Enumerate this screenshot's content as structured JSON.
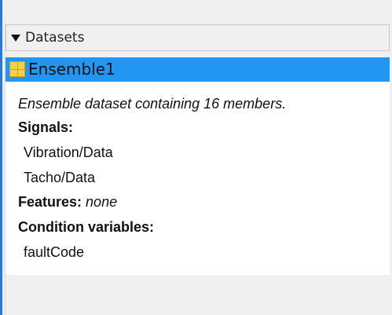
{
  "panel": {
    "section_title": "Datasets",
    "selected_item": "Ensemble1",
    "description": "Ensemble dataset containing 16 members.",
    "signals_label": "Signals:",
    "signals": [
      "Vibration/Data",
      "Tacho/Data"
    ],
    "features_label": "Features:",
    "features_value": "none",
    "condition_variables_label": "Condition variables:",
    "condition_variables": [
      "faultCode"
    ]
  },
  "colors": {
    "accent": "#2e78d2",
    "selected_row": "#2196f3",
    "icon_fill": "#f3d04a"
  },
  "icons": {
    "section_toggle": "caret-down-icon",
    "ensemble": "grid-icon"
  }
}
